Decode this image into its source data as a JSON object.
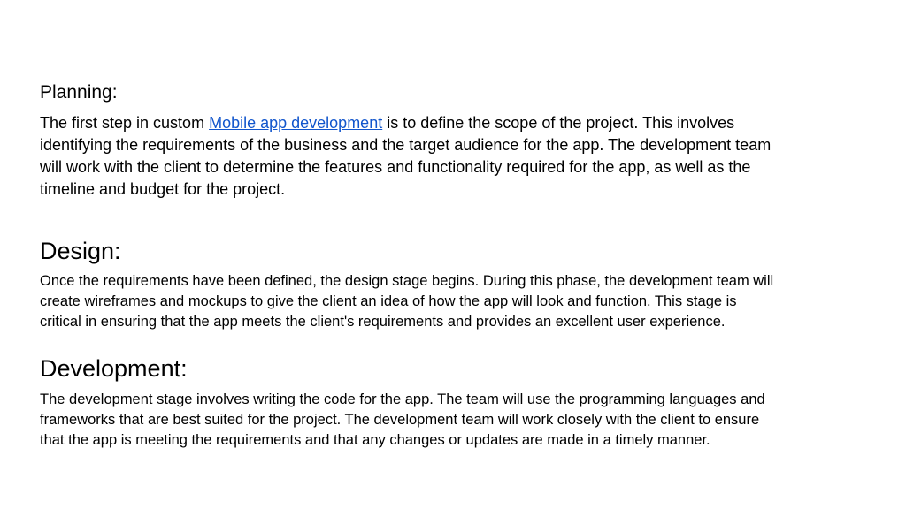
{
  "sections": {
    "planning": {
      "heading": "Planning:",
      "body_before_link": "The first step in custom ",
      "link_text": "Mobile app development",
      "body_after_link": " is to define the scope of the project. This involves\nidentifying the requirements of the business and the target audience for the app. The development team\nwill work with the client to determine the features and functionality required for the app, as well as the\ntimeline and budget for the project."
    },
    "design": {
      "heading": "Design:",
      "body": "Once the requirements have been defined, the design stage begins. During this phase, the development team will\ncreate wireframes and mockups to give the client an idea of how the app will look and function. This stage is\ncritical in ensuring that the app meets the client's requirements and provides an excellent user experience."
    },
    "development": {
      "heading": "Development:",
      "body": "The development stage involves writing the code for the app. The team will use the programming languages and\nframeworks that are best suited for the project. The development team will work closely with the client to ensure\nthat the app is meeting the requirements and that any changes or updates are made in a timely manner."
    }
  },
  "colors": {
    "link": "#1155cc",
    "text": "#000000",
    "background": "#ffffff"
  }
}
